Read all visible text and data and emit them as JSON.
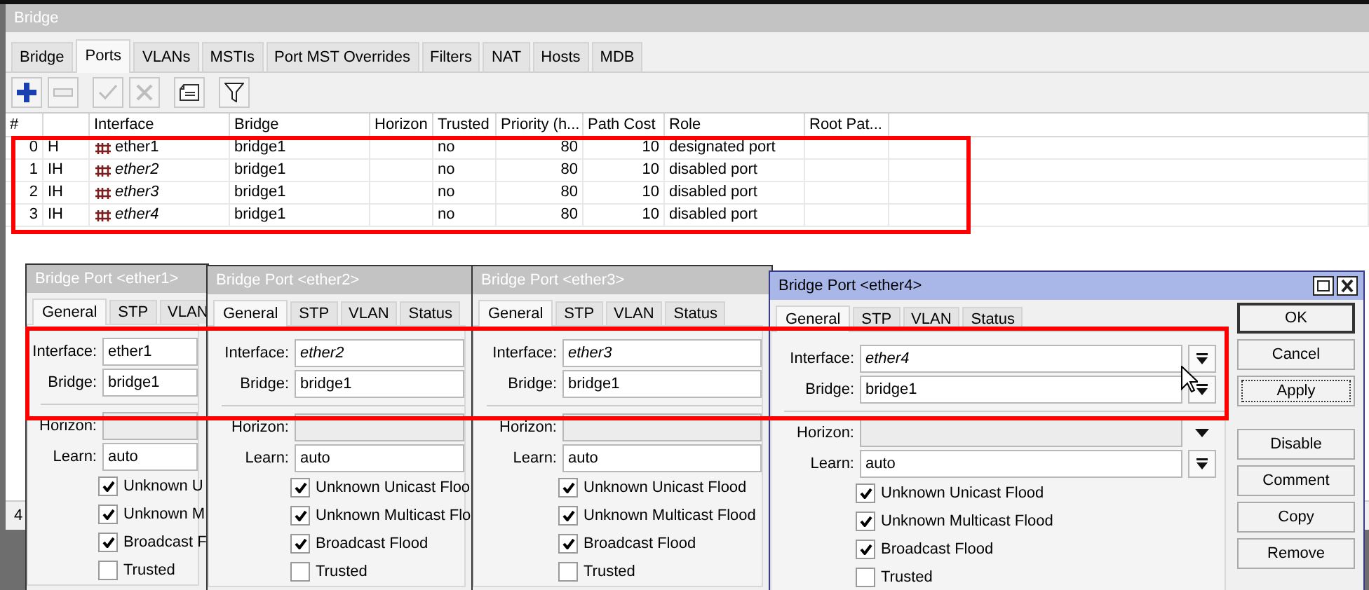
{
  "window": {
    "title": "Bridge"
  },
  "tabs": [
    {
      "label": "Bridge",
      "selected": false
    },
    {
      "label": "Ports",
      "selected": true
    },
    {
      "label": "VLANs",
      "selected": false
    },
    {
      "label": "MSTIs",
      "selected": false
    },
    {
      "label": "Port MST Overrides",
      "selected": false
    },
    {
      "label": "Filters",
      "selected": false
    },
    {
      "label": "NAT",
      "selected": false
    },
    {
      "label": "Hosts",
      "selected": false
    },
    {
      "label": "MDB",
      "selected": false
    }
  ],
  "toolbar": [
    {
      "kind": "add",
      "disabled": false
    },
    {
      "kind": "remove",
      "disabled": true
    },
    {
      "kind": "enable",
      "disabled": true
    },
    {
      "kind": "disable",
      "disabled": true
    },
    {
      "kind": "comment",
      "disabled": false
    },
    {
      "kind": "filter",
      "disabled": false
    }
  ],
  "table": {
    "columns": [
      "#",
      "Interface",
      "Bridge",
      "Horizon",
      "Trusted",
      "Priority (h...",
      "Path Cost",
      "Role",
      "Root Pat..."
    ],
    "rows": [
      {
        "number": "0",
        "flags": "H",
        "interface": "ether1",
        "disabled": false,
        "bridge": "bridge1",
        "trusted": "no",
        "priority": "80",
        "path_cost": "10",
        "role": "designated port"
      },
      {
        "number": "1",
        "flags": "IH",
        "interface": "ether2",
        "disabled": true,
        "bridge": "bridge1",
        "trusted": "no",
        "priority": "80",
        "path_cost": "10",
        "role": "disabled port"
      },
      {
        "number": "2",
        "flags": "IH",
        "interface": "ether3",
        "disabled": true,
        "bridge": "bridge1",
        "trusted": "no",
        "priority": "80",
        "path_cost": "10",
        "role": "disabled port"
      },
      {
        "number": "3",
        "flags": "IH",
        "interface": "ether4",
        "disabled": true,
        "bridge": "bridge1",
        "trusted": "no",
        "priority": "80",
        "path_cost": "10",
        "role": "disabled port"
      }
    ]
  },
  "status_bar": "4",
  "dialogs": [
    {
      "title": "Bridge Port <ether1>",
      "active": false,
      "tabs": [
        {
          "label": "General",
          "selected": true
        },
        {
          "label": "STP",
          "selected": false
        },
        {
          "label": "VLAN",
          "selected": false
        }
      ],
      "fields": [
        {
          "label": "Interface:",
          "value": "ether1",
          "disabled": false
        },
        {
          "label": "Bridge:",
          "value": "bridge1",
          "disabled": false
        },
        {
          "label": "Horizon:"
        },
        {
          "label": "Learn:",
          "value": "auto",
          "disabled": false
        }
      ],
      "checkboxes": [
        {
          "label": "Unknown U",
          "checked": true
        },
        {
          "label": "Unknown M",
          "checked": true
        },
        {
          "label": "Broadcast F",
          "checked": true
        },
        {
          "label": "Trusted",
          "checked": false
        }
      ]
    },
    {
      "title": "Bridge Port <ether2>",
      "active": false,
      "tabs": [
        {
          "label": "General",
          "selected": true
        },
        {
          "label": "STP",
          "selected": false
        },
        {
          "label": "VLAN",
          "selected": false
        },
        {
          "label": "Status",
          "selected": false
        }
      ],
      "fields": [
        {
          "label": "Interface:",
          "value": "ether2",
          "disabled": true
        },
        {
          "label": "Bridge:",
          "value": "bridge1",
          "disabled": false
        },
        {
          "label": "Horizon:"
        },
        {
          "label": "Learn:",
          "value": "auto",
          "disabled": false
        }
      ],
      "checkboxes": [
        {
          "label": "Unknown Unicast Floo",
          "checked": true
        },
        {
          "label": "Unknown Multicast Flo",
          "checked": true
        },
        {
          "label": "Broadcast Flood",
          "checked": true
        },
        {
          "label": "Trusted",
          "checked": false
        }
      ]
    },
    {
      "title": "Bridge Port <ether3>",
      "active": false,
      "tabs": [
        {
          "label": "General",
          "selected": true
        },
        {
          "label": "STP",
          "selected": false
        },
        {
          "label": "VLAN",
          "selected": false
        },
        {
          "label": "Status",
          "selected": false
        }
      ],
      "fields": [
        {
          "label": "Interface:",
          "value": "ether3",
          "disabled": true
        },
        {
          "label": "Bridge:",
          "value": "bridge1",
          "disabled": false
        },
        {
          "label": "Horizon:"
        },
        {
          "label": "Learn:",
          "value": "auto",
          "disabled": false
        }
      ],
      "checkboxes": [
        {
          "label": "Unknown Unicast Flood",
          "checked": true
        },
        {
          "label": "Unknown Multicast Flood",
          "checked": true
        },
        {
          "label": "Broadcast Flood",
          "checked": true
        },
        {
          "label": "Trusted",
          "checked": false
        }
      ]
    },
    {
      "title": "Bridge Port <ether4>",
      "active": true,
      "tabs": [
        {
          "label": "General",
          "selected": true
        },
        {
          "label": "STP",
          "selected": false
        },
        {
          "label": "VLAN",
          "selected": false
        },
        {
          "label": "Status",
          "selected": false
        }
      ],
      "fields": [
        {
          "label": "Interface:",
          "value": "ether4",
          "disabled": true,
          "kind": "combo"
        },
        {
          "label": "Bridge:",
          "value": "bridge1",
          "disabled": false,
          "kind": "combo"
        },
        {
          "label": "Horizon:",
          "kind": "dropdown"
        },
        {
          "label": "Learn:",
          "value": "auto",
          "disabled": false,
          "kind": "combo"
        }
      ],
      "checkboxes": [
        {
          "label": "Unknown Unicast Flood",
          "checked": true
        },
        {
          "label": "Unknown Multicast Flood",
          "checked": true
        },
        {
          "label": "Broadcast Flood",
          "checked": true
        },
        {
          "label": "Trusted",
          "checked": false
        }
      ],
      "buttons": [
        {
          "label": "OK",
          "kind": "default"
        },
        {
          "label": "Cancel",
          "kind": "normal"
        },
        {
          "label": "Apply",
          "kind": "focused"
        },
        {
          "label": "Disable",
          "kind": "normal"
        },
        {
          "label": "Comment",
          "kind": "normal"
        },
        {
          "label": "Copy",
          "kind": "normal"
        },
        {
          "label": "Remove",
          "kind": "normal"
        }
      ]
    }
  ]
}
